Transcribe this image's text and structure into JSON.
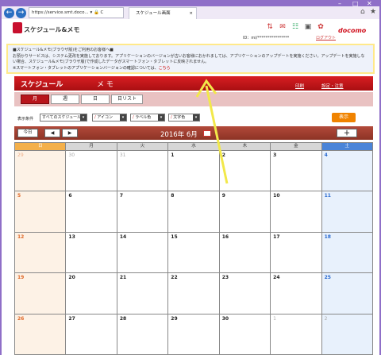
{
  "browser": {
    "address": "https://service.smt.doco...",
    "addr_icons": "▾ 🔒 C",
    "tab_title": "スケジュール画面",
    "tab_close": "×",
    "win_minimize": "–",
    "win_maximize": "□",
    "win_close": "✕"
  },
  "header": {
    "app_title": "スケジュール&メモ",
    "brand": "docomo",
    "id_line": "ID：mi/****************",
    "logout": "ログアウト"
  },
  "notice": {
    "heading": "■スケジュール&メモ(ブラウザ版)をご利用のお客様へ■",
    "body": "お預かりサービスは、システム更改を実施しております。アプリケーションのバージョンが古いお客様におかれましては、アプリケーションのアップデートを実施ください。アップデートを実施しない場合、スケジュール&メモ(ブラウザ版)で作成したデータがスマートフォン・タブレットに反映されません。",
    "note": "※スマートフォン・タブレットのアプリケーションバージョンの確認については、",
    "link": "こちら"
  },
  "nav": {
    "schedule_tab": "スケジュール",
    "memo_tab": "メ モ",
    "print": "印刷",
    "settings": "設定・注意"
  },
  "views": {
    "month": "月",
    "week": "週",
    "day": "日",
    "list": "日リスト"
  },
  "filter": {
    "label": "表示条件",
    "schedule_select": "すべてのスケジュール",
    "icon_select": "アイコン",
    "label_color": "ラベル色",
    "text_color": "文字色",
    "show_button": "表示"
  },
  "calendar": {
    "today": "今日",
    "prev": "◀",
    "next": "▶",
    "month_label": "2016年 6月",
    "add": "＋",
    "weekdays": [
      "日",
      "月",
      "火",
      "水",
      "木",
      "金",
      "土"
    ],
    "weeks": [
      [
        "29",
        "30",
        "31",
        "1",
        "2",
        "3",
        "4"
      ],
      [
        "5",
        "6",
        "7",
        "8",
        "9",
        "10",
        "11"
      ],
      [
        "12",
        "13",
        "14",
        "15",
        "16",
        "17",
        "18"
      ],
      [
        "19",
        "20",
        "21",
        "22",
        "23",
        "24",
        "25"
      ],
      [
        "26",
        "27",
        "28",
        "29",
        "30",
        "1",
        "2"
      ]
    ]
  },
  "colors": {
    "brand_red": "#c8102e",
    "sunday": "#f4b04a",
    "saturday": "#4a84d8",
    "highlight": "#ffe98a"
  }
}
